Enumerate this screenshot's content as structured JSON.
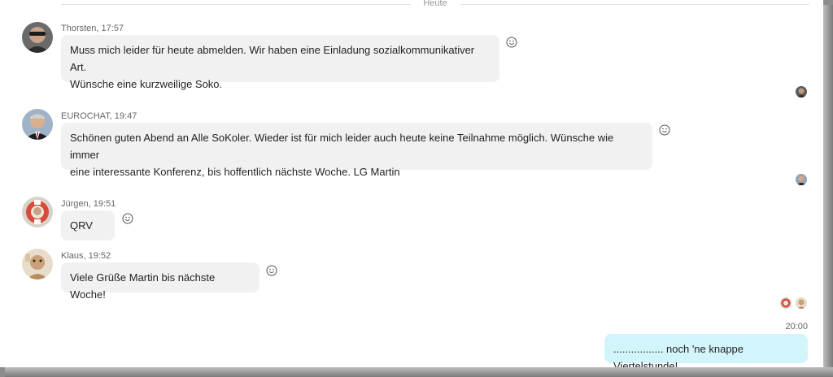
{
  "day_separator": "Heute",
  "messages": [
    {
      "meta": "Thorsten, 17:57",
      "lines": [
        "Muss mich leider für heute abmelden. Wir haben eine Einladung sozialkommunikativer Art.",
        "Wünsche eine kurzweilige Soko."
      ]
    },
    {
      "meta": "EUROCHAT, 19:47",
      "lines": [
        "Schönen guten Abend an Alle SoKoler. Wieder ist für mich leider auch heute keine Teilnahme möglich. Wünsche wie immer",
        "eine interessante Konferenz, bis hoffentlich nächste Woche. LG Martin"
      ]
    },
    {
      "meta": "Jürgen, 19:51",
      "lines": [
        "QRV"
      ]
    },
    {
      "meta": "Klaus, 19:52",
      "lines": [
        "Viele Grüße Martin bis nächste Woche!"
      ]
    }
  ],
  "own_message": {
    "time": "20:00",
    "text": "................. noch 'ne knappe Viertelstunde!"
  },
  "icons": {
    "reaction": "smiley-icon"
  },
  "colors": {
    "bubble": "#f1f1f1",
    "own_bubble": "#d2f5fb",
    "frame_shadow": "#8c8c8c"
  }
}
